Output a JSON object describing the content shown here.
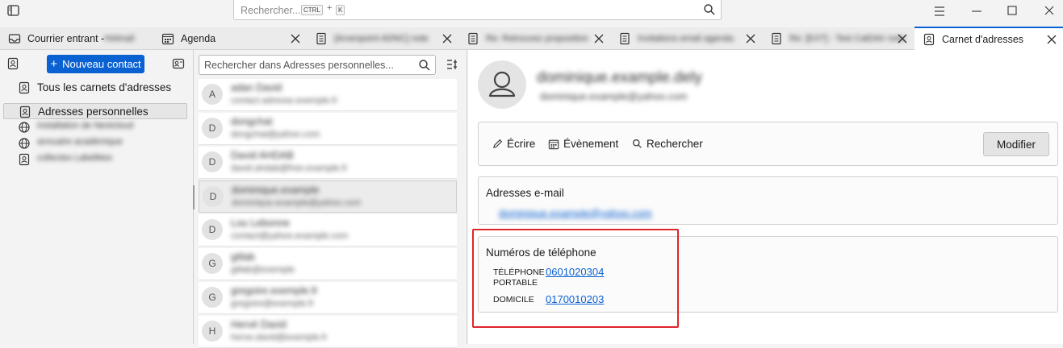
{
  "titlebar": {
    "search_placeholder": "Rechercher...",
    "shortcut_ctrl": "CTRL",
    "shortcut_plus": "+",
    "shortcut_key": "K"
  },
  "tabs": [
    {
      "label": "Courrier entrant - ",
      "blurred_suffix": "Hotmail"
    },
    {
      "label": "Agenda"
    },
    {
      "label": "",
      "blurred_suffix": "[Arvenpoint ADNC] note"
    },
    {
      "label": "",
      "blurred_suffix": "Re: Retrouvez proposition"
    },
    {
      "label": "",
      "blurred_suffix": "Invitations email agenda"
    },
    {
      "label": "",
      "blurred_suffix": "Re: [EXT] - Test CalDAV note"
    },
    {
      "label": "Carnet d'adresses"
    }
  ],
  "sidebar": {
    "new_contact_label": "Nouveau contact",
    "items": [
      {
        "label": "Tous les carnets d'adresses",
        "icon": "address-book-icon"
      },
      {
        "label": "Adresses personnelles",
        "icon": "address-book-icon",
        "selected": true
      },
      {
        "label": "",
        "blurred": "installation de Nextcloud",
        "icon": "globe-icon"
      },
      {
        "label": "",
        "blurred": "annuaire académique",
        "icon": "globe-icon"
      },
      {
        "label": "",
        "blurred": "collectes Labellées",
        "icon": "address-book-icon"
      }
    ]
  },
  "contacts": {
    "search_placeholder": "Rechercher dans Adresses personnelles...",
    "items": [
      {
        "initial": "A",
        "name": "adan David",
        "email": "contact.adresse.exemple.fr"
      },
      {
        "initial": "D",
        "name": "dongchat",
        "email": "dongchat@yahoo.com"
      },
      {
        "initial": "D",
        "name": "David AHDAB",
        "email": "david.ahdab@free.example.fr"
      },
      {
        "initial": "D",
        "name": "dominique.example",
        "email": "dominique.example@yahoo.com",
        "selected": true
      },
      {
        "initial": "D",
        "name": "Lou Lebonne",
        "email": "contact@yahoo.example.com"
      },
      {
        "initial": "G",
        "name": "gitlab",
        "email": "gitlab@exemple"
      },
      {
        "initial": "G",
        "name": "gregoire.exemple.fr",
        "email": "gregoire@exemple.fr"
      },
      {
        "initial": "H",
        "name": "Hervé David",
        "email": "herve.david@exemple.fr"
      }
    ]
  },
  "detail": {
    "display_name": "dominique.example.dely",
    "display_email": "dominique.example@yahoo.com",
    "actions": {
      "write": "Écrire",
      "event": "Évènement",
      "search": "Rechercher",
      "edit": "Modifier"
    },
    "email_section": {
      "title": "Adresses e-mail",
      "email": "dominique.example@yahoo.com"
    },
    "phone_section": {
      "title": "Numéros de téléphone",
      "phones": [
        {
          "type_line1": "TÉLÉPHONE",
          "type_line2": "PORTABLE",
          "number": "0601020304"
        },
        {
          "type_line1": "DOMICILE",
          "type_line2": "",
          "number": "0170010203"
        }
      ]
    }
  },
  "colors": {
    "accent": "#0a61d1",
    "highlight": "#e0242b"
  }
}
